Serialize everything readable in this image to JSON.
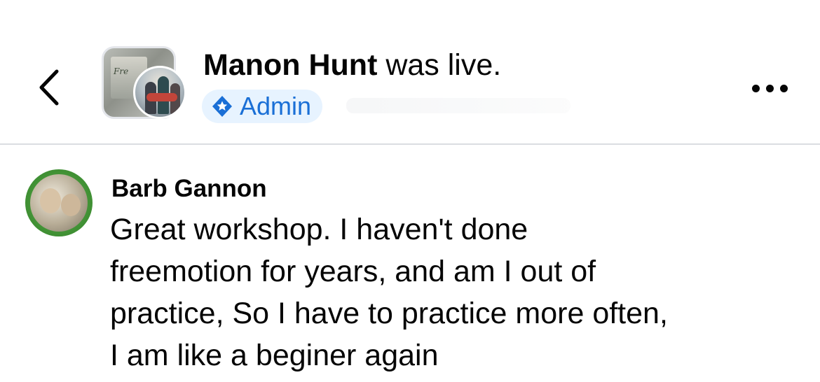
{
  "header": {
    "back_icon": "chevron-left-icon",
    "author_name": "Manon Hunt",
    "status_text": "was live.",
    "badge": {
      "icon": "admin-shield-icon",
      "label": "Admin",
      "color": "#1a6fd6",
      "background": "#e7f3ff"
    },
    "more_icon": "more-options-icon"
  },
  "comment": {
    "author": "Barb Gannon",
    "lines": [
      "Great workshop.  I haven't done",
      "freemotion for years, and am I out of",
      "practice, So I have to practice more often,",
      "I am like a beginer again"
    ]
  },
  "colors": {
    "text": "#050505",
    "divider": "#dadde1",
    "accent": "#1a6fd6"
  }
}
